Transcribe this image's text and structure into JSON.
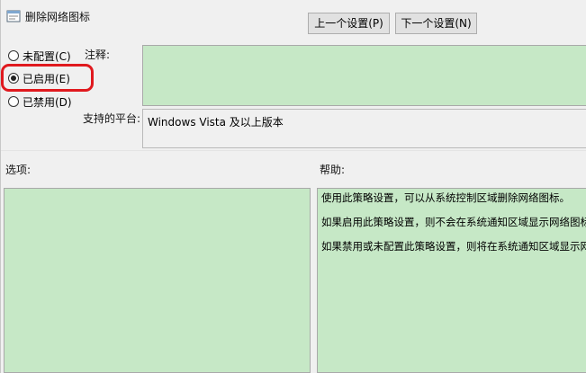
{
  "window": {
    "title": "删除网络图标"
  },
  "nav": {
    "prev_label": "上一个设置(P)",
    "next_label": "下一个设置(N)"
  },
  "state": {
    "options": [
      {
        "label": "未配置(C)",
        "checked": false
      },
      {
        "label": "已启用(E)",
        "checked": true
      },
      {
        "label": "已禁用(D)",
        "checked": false
      }
    ],
    "highlight_color": "#e0191e"
  },
  "comment": {
    "label": "注释:",
    "value": ""
  },
  "platform": {
    "label": "支持的平台:",
    "value": "Windows Vista 及以上版本"
  },
  "options_section": {
    "label": "选项:"
  },
  "help_section": {
    "label": "帮助:",
    "lines": [
      "使用此策略设置，可以从系统控制区域删除网络图标。",
      "如果启用此策略设置，则不会在系统通知区域显示网络图标。",
      "如果禁用或未配置此策略设置，则将在系统通知区域显示网络图标。"
    ]
  },
  "colors": {
    "pane_bg": "#c6e8c6",
    "window_bg": "#f0f0f0"
  }
}
